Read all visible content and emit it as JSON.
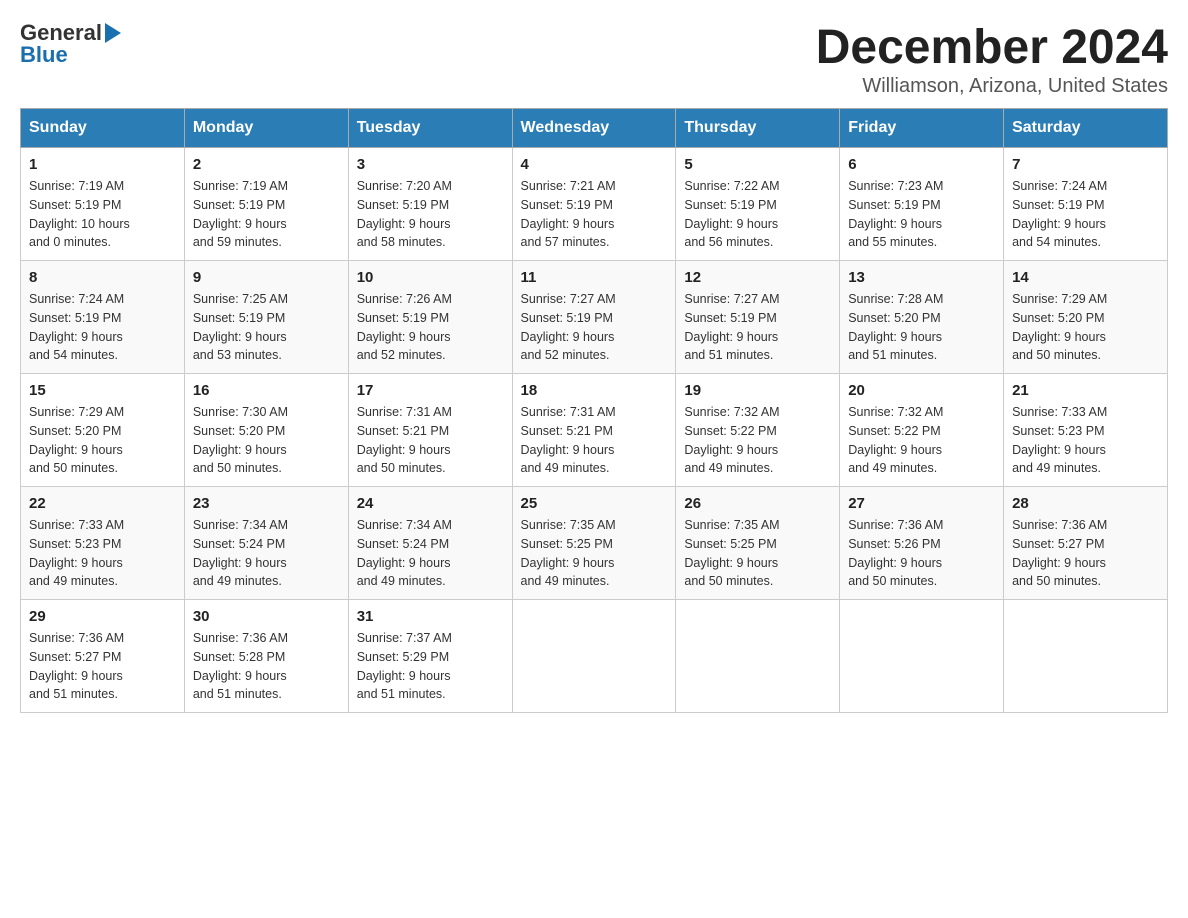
{
  "header": {
    "logo_general": "General",
    "logo_blue": "Blue",
    "month_title": "December 2024",
    "location": "Williamson, Arizona, United States"
  },
  "days_of_week": [
    "Sunday",
    "Monday",
    "Tuesday",
    "Wednesday",
    "Thursday",
    "Friday",
    "Saturday"
  ],
  "weeks": [
    [
      {
        "day": "1",
        "sunrise": "7:19 AM",
        "sunset": "5:19 PM",
        "daylight": "10 hours and 0 minutes."
      },
      {
        "day": "2",
        "sunrise": "7:19 AM",
        "sunset": "5:19 PM",
        "daylight": "9 hours and 59 minutes."
      },
      {
        "day": "3",
        "sunrise": "7:20 AM",
        "sunset": "5:19 PM",
        "daylight": "9 hours and 58 minutes."
      },
      {
        "day": "4",
        "sunrise": "7:21 AM",
        "sunset": "5:19 PM",
        "daylight": "9 hours and 57 minutes."
      },
      {
        "day": "5",
        "sunrise": "7:22 AM",
        "sunset": "5:19 PM",
        "daylight": "9 hours and 56 minutes."
      },
      {
        "day": "6",
        "sunrise": "7:23 AM",
        "sunset": "5:19 PM",
        "daylight": "9 hours and 55 minutes."
      },
      {
        "day": "7",
        "sunrise": "7:24 AM",
        "sunset": "5:19 PM",
        "daylight": "9 hours and 54 minutes."
      }
    ],
    [
      {
        "day": "8",
        "sunrise": "7:24 AM",
        "sunset": "5:19 PM",
        "daylight": "9 hours and 54 minutes."
      },
      {
        "day": "9",
        "sunrise": "7:25 AM",
        "sunset": "5:19 PM",
        "daylight": "9 hours and 53 minutes."
      },
      {
        "day": "10",
        "sunrise": "7:26 AM",
        "sunset": "5:19 PM",
        "daylight": "9 hours and 52 minutes."
      },
      {
        "day": "11",
        "sunrise": "7:27 AM",
        "sunset": "5:19 PM",
        "daylight": "9 hours and 52 minutes."
      },
      {
        "day": "12",
        "sunrise": "7:27 AM",
        "sunset": "5:19 PM",
        "daylight": "9 hours and 51 minutes."
      },
      {
        "day": "13",
        "sunrise": "7:28 AM",
        "sunset": "5:20 PM",
        "daylight": "9 hours and 51 minutes."
      },
      {
        "day": "14",
        "sunrise": "7:29 AM",
        "sunset": "5:20 PM",
        "daylight": "9 hours and 50 minutes."
      }
    ],
    [
      {
        "day": "15",
        "sunrise": "7:29 AM",
        "sunset": "5:20 PM",
        "daylight": "9 hours and 50 minutes."
      },
      {
        "day": "16",
        "sunrise": "7:30 AM",
        "sunset": "5:20 PM",
        "daylight": "9 hours and 50 minutes."
      },
      {
        "day": "17",
        "sunrise": "7:31 AM",
        "sunset": "5:21 PM",
        "daylight": "9 hours and 50 minutes."
      },
      {
        "day": "18",
        "sunrise": "7:31 AM",
        "sunset": "5:21 PM",
        "daylight": "9 hours and 49 minutes."
      },
      {
        "day": "19",
        "sunrise": "7:32 AM",
        "sunset": "5:22 PM",
        "daylight": "9 hours and 49 minutes."
      },
      {
        "day": "20",
        "sunrise": "7:32 AM",
        "sunset": "5:22 PM",
        "daylight": "9 hours and 49 minutes."
      },
      {
        "day": "21",
        "sunrise": "7:33 AM",
        "sunset": "5:23 PM",
        "daylight": "9 hours and 49 minutes."
      }
    ],
    [
      {
        "day": "22",
        "sunrise": "7:33 AM",
        "sunset": "5:23 PM",
        "daylight": "9 hours and 49 minutes."
      },
      {
        "day": "23",
        "sunrise": "7:34 AM",
        "sunset": "5:24 PM",
        "daylight": "9 hours and 49 minutes."
      },
      {
        "day": "24",
        "sunrise": "7:34 AM",
        "sunset": "5:24 PM",
        "daylight": "9 hours and 49 minutes."
      },
      {
        "day": "25",
        "sunrise": "7:35 AM",
        "sunset": "5:25 PM",
        "daylight": "9 hours and 49 minutes."
      },
      {
        "day": "26",
        "sunrise": "7:35 AM",
        "sunset": "5:25 PM",
        "daylight": "9 hours and 50 minutes."
      },
      {
        "day": "27",
        "sunrise": "7:36 AM",
        "sunset": "5:26 PM",
        "daylight": "9 hours and 50 minutes."
      },
      {
        "day": "28",
        "sunrise": "7:36 AM",
        "sunset": "5:27 PM",
        "daylight": "9 hours and 50 minutes."
      }
    ],
    [
      {
        "day": "29",
        "sunrise": "7:36 AM",
        "sunset": "5:27 PM",
        "daylight": "9 hours and 51 minutes."
      },
      {
        "day": "30",
        "sunrise": "7:36 AM",
        "sunset": "5:28 PM",
        "daylight": "9 hours and 51 minutes."
      },
      {
        "day": "31",
        "sunrise": "7:37 AM",
        "sunset": "5:29 PM",
        "daylight": "9 hours and 51 minutes."
      },
      null,
      null,
      null,
      null
    ]
  ],
  "labels": {
    "sunrise": "Sunrise:",
    "sunset": "Sunset:",
    "daylight": "Daylight:"
  }
}
